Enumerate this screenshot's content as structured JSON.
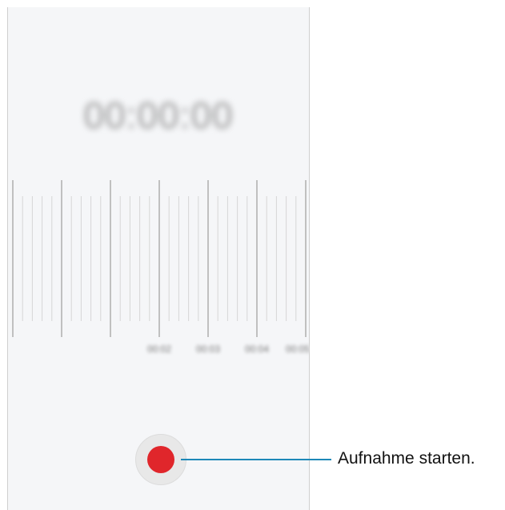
{
  "screen": {
    "timer": "00:00:00",
    "time_labels": [
      "00:02",
      "00:03",
      "00:04",
      "00:05"
    ]
  },
  "record": {
    "icon": "record-icon",
    "color": "#e0262b"
  },
  "callout": {
    "text": "Aufnahme starten.",
    "line_color": "#1d88b8"
  }
}
